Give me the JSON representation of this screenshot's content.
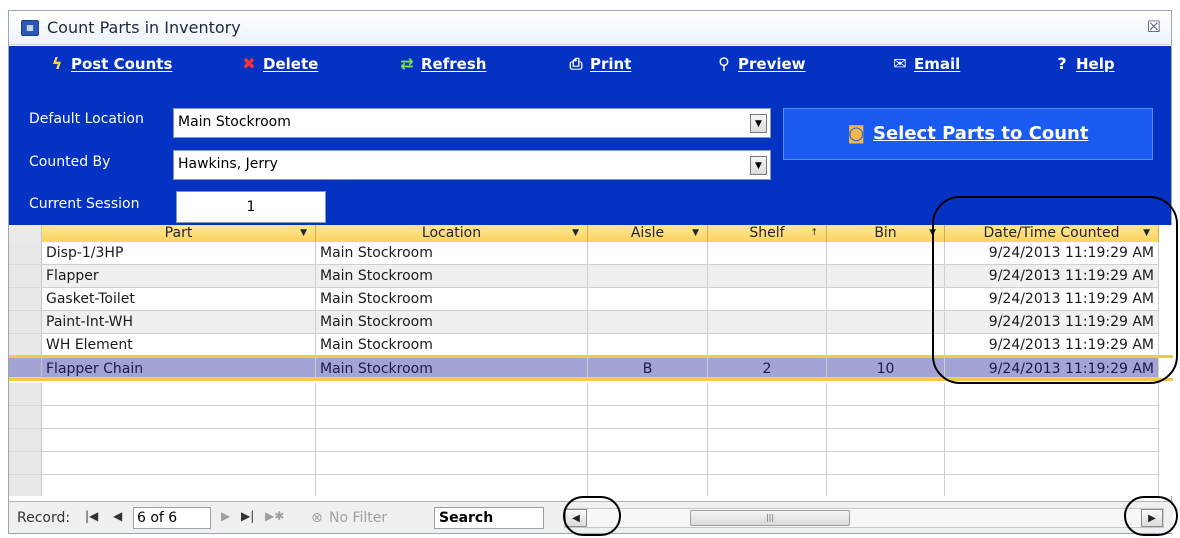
{
  "window": {
    "title": "Count Parts in Inventory",
    "close_glyph": "☒"
  },
  "toolbar": {
    "post_counts": "Post Counts",
    "delete": "Delete",
    "refresh": "Refresh",
    "print": "Print",
    "preview": "Preview",
    "email": "Email",
    "help": "Help"
  },
  "form": {
    "default_location_label": "Default Location",
    "default_location_value": "Main Stockroom",
    "counted_by_label": "Counted By",
    "counted_by_value": "Hawkins, Jerry",
    "current_session_label": "Current Session",
    "current_session_value": "1"
  },
  "select_button": "Select Parts to Count",
  "grid": {
    "columns": [
      "Part",
      "Location",
      "Aisle",
      "Shelf",
      "Bin",
      "Date/Time Counted"
    ],
    "rows": [
      {
        "part": "Disp-1/3HP",
        "location": "Main Stockroom",
        "aisle": "",
        "shelf": "",
        "bin": "",
        "counted": "9/24/2013 11:19:29 AM"
      },
      {
        "part": "Flapper",
        "location": "Main Stockroom",
        "aisle": "",
        "shelf": "",
        "bin": "",
        "counted": "9/24/2013 11:19:29 AM"
      },
      {
        "part": "Gasket-Toilet",
        "location": "Main Stockroom",
        "aisle": "",
        "shelf": "",
        "bin": "",
        "counted": "9/24/2013 11:19:29 AM"
      },
      {
        "part": "Paint-Int-WH",
        "location": "Main Stockroom",
        "aisle": "",
        "shelf": "",
        "bin": "",
        "counted": "9/24/2013 11:19:29 AM"
      },
      {
        "part": "WH Element",
        "location": "Main Stockroom",
        "aisle": "",
        "shelf": "",
        "bin": "",
        "counted": "9/24/2013 11:19:29 AM"
      },
      {
        "part": "Flapper Chain",
        "location": "Main Stockroom",
        "aisle": "B",
        "shelf": "2",
        "bin": "10",
        "counted": "9/24/2013 11:19:29 AM"
      }
    ],
    "selected_row": 5
  },
  "nav": {
    "record_label": "Record:",
    "record_value": "6 of 6",
    "no_filter": "No Filter",
    "search": "Search"
  },
  "colors": {
    "panel_blue": "#0433c4",
    "button_blue": "#1a5af0",
    "header_gold": "#fcd55c",
    "selected_row": "#a3a3d6"
  }
}
